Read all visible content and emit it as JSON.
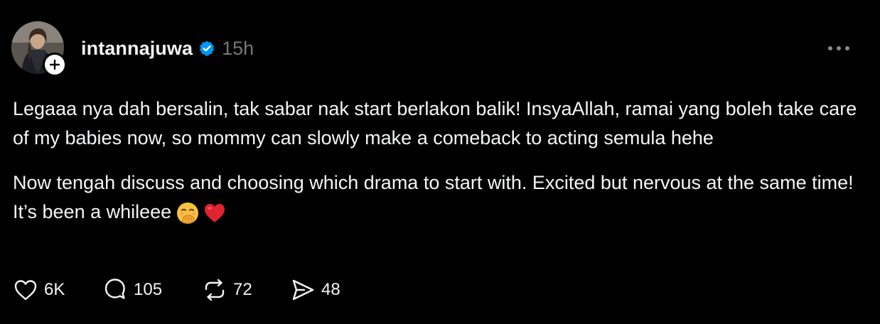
{
  "post": {
    "username": "intannajuwa",
    "timestamp": "15h",
    "verified": true,
    "paragraphs": [
      "Legaaa nya dah bersalin, tak sabar nak start berlakon balik! InsyaAllah, ramai yang boleh take care of my babies now, so mommy can slowly make a comeback to acting semula hehe",
      "Now tengah discuss and choosing which drama to start with. Excited but nervous at the same time! It’s been a whileee"
    ],
    "emojis": [
      "face-with-hand-over-mouth-emoji",
      "red-heart-emoji"
    ]
  },
  "actions": {
    "likes": "6K",
    "replies": "105",
    "reposts": "72",
    "shares": "48"
  },
  "icons": {
    "more": "more-horizontal-icon",
    "like": "heart-icon",
    "reply": "comment-icon",
    "repost": "repost-icon",
    "share": "send-icon",
    "verified": "verified-badge-icon",
    "follow": "plus-icon"
  },
  "colors": {
    "background": "#000000",
    "text": "#f3f5f7",
    "muted": "#777777",
    "verified": "#0095f6"
  }
}
